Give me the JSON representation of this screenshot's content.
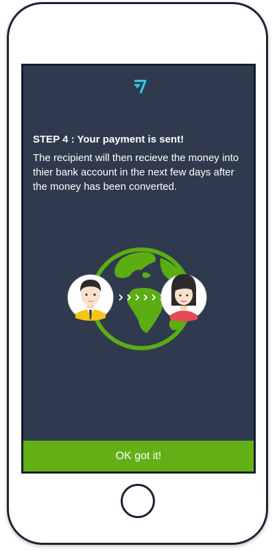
{
  "step": {
    "title": "STEP 4 : Your payment is sent!",
    "description": "The recipient will then recieve the money into thier bank account in the next few days after the money has been converted."
  },
  "button": {
    "label": "OK got it!"
  },
  "colors": {
    "screen_bg": "#2f3a4e",
    "accent_green": "#62b015",
    "logo_blue": "#2ed3f2",
    "globe_green": "#5cac14"
  },
  "icons": {
    "logo": "brand-logo-icon",
    "illustration": "transfer-globe-illustration"
  }
}
